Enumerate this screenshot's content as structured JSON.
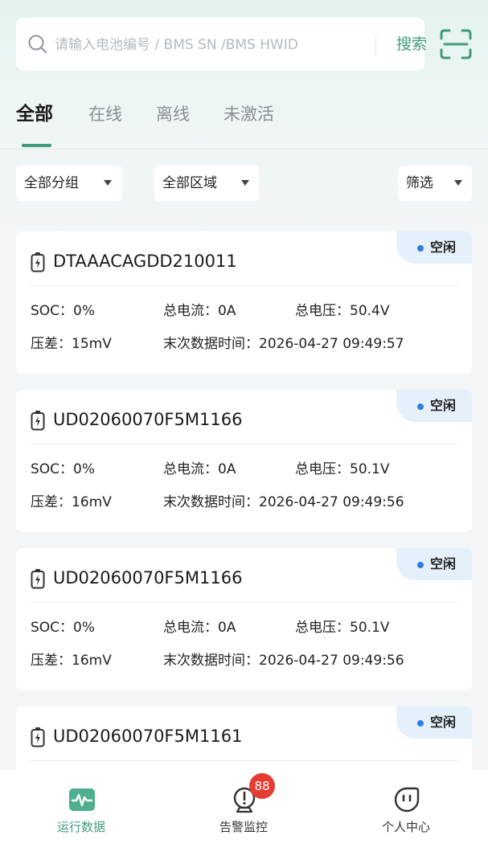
{
  "search": {
    "placeholder": "请输入电池编号 / BMS SN /BMS HWID",
    "value": "",
    "button_label": "搜索"
  },
  "tabs": [
    {
      "label": "全部",
      "active": true
    },
    {
      "label": "在线",
      "active": false
    },
    {
      "label": "离线",
      "active": false
    },
    {
      "label": "未激活",
      "active": false
    }
  ],
  "filters": {
    "group": "全部分组",
    "region": "全部区域",
    "screen": "筛选"
  },
  "labels": {
    "soc": "SOC：",
    "current": "总电流：",
    "voltage": "总电压：",
    "diff": "压差：",
    "last_time": "末次数据时间："
  },
  "cards": [
    {
      "status": "空闲",
      "sn": "DTAAACAGDD210011",
      "soc": "0%",
      "current": "0A",
      "voltage": "50.4V",
      "diff": "15mV",
      "last_time": "2026-04-27 09:49:57"
    },
    {
      "status": "空闲",
      "sn": "UD02060070F5M1166",
      "soc": "0%",
      "current": "0A",
      "voltage": "50.1V",
      "diff": "16mV",
      "last_time": "2026-04-27 09:49:56"
    },
    {
      "status": "空闲",
      "sn": "UD02060070F5M1166",
      "soc": "0%",
      "current": "0A",
      "voltage": "50.1V",
      "diff": "16mV",
      "last_time": "2026-04-27 09:49:56"
    },
    {
      "status": "空闲",
      "sn": "UD02060070F5M1161"
    }
  ],
  "nav": [
    {
      "label": "运行数据",
      "icon": "pulse-icon",
      "active": true
    },
    {
      "label": "告警监控",
      "icon": "alarm-icon",
      "active": false,
      "badge": "88"
    },
    {
      "label": "个人中心",
      "icon": "face-icon",
      "active": false
    }
  ],
  "colors": {
    "accent": "#3f9b7b",
    "status_dot": "#2f7de1",
    "status_bg": "#e5f0fb",
    "badge": "#e53b33"
  }
}
